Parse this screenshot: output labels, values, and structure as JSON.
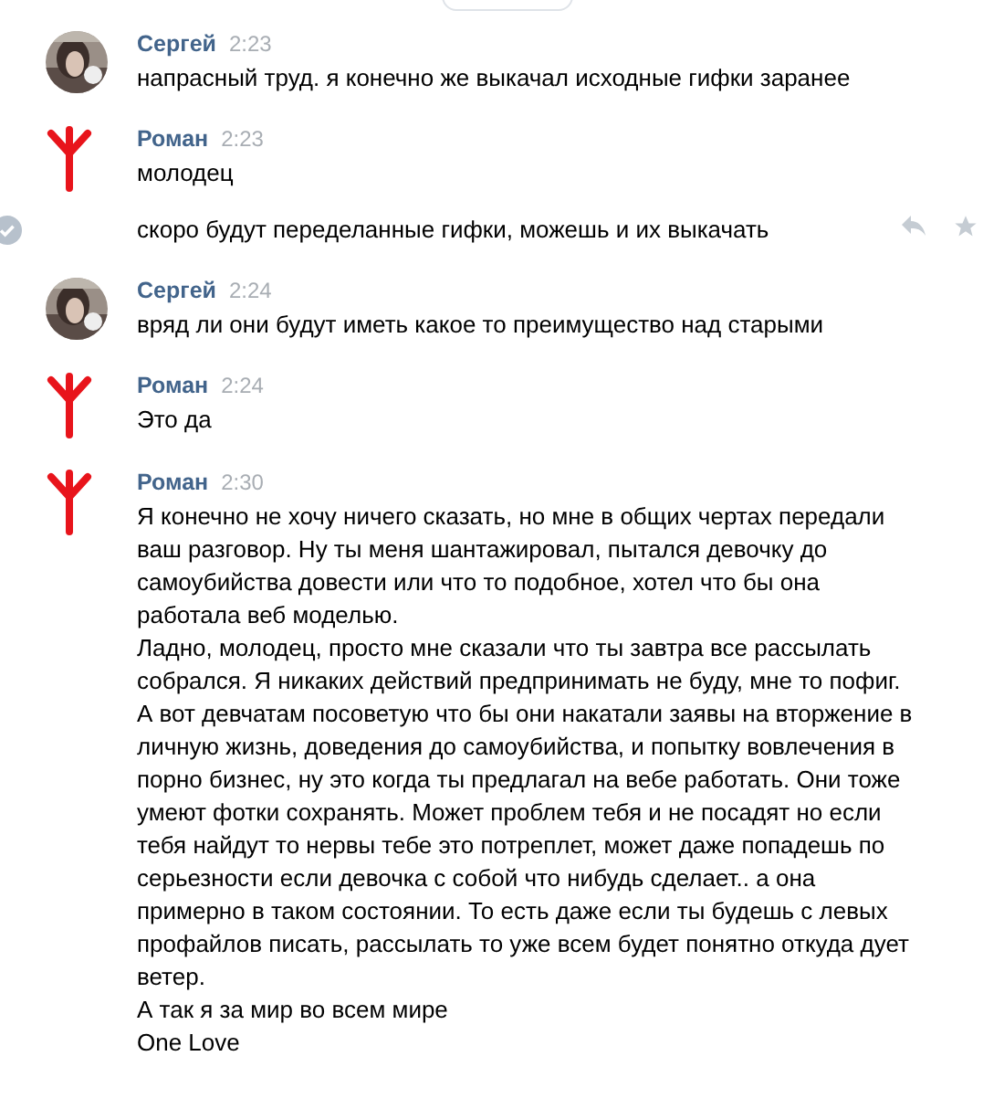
{
  "groups": [
    {
      "author": "Сергей",
      "time": "2:23",
      "messages": [
        {
          "text": [
            "напрасный труд. я конечно же выкачал исходные гифки заранее"
          ],
          "show_actions": false
        }
      ]
    },
    {
      "author": "Роман",
      "time": "2:23",
      "kind": "rune",
      "messages": [
        {
          "text": [
            "молодец"
          ],
          "show_actions": false
        },
        {
          "text": [
            "скоро будут переделанные гифки, можешь и их выкачать"
          ],
          "show_actions": true
        }
      ]
    },
    {
      "author": "Сергей",
      "time": "2:24",
      "messages": [
        {
          "text": [
            "вряд ли они будут иметь какое то преимущество над старыми"
          ],
          "show_actions": false
        }
      ]
    },
    {
      "author": "Роман",
      "time": "2:24",
      "kind": "rune",
      "messages": [
        {
          "text": [
            "Это да"
          ],
          "show_actions": false
        }
      ]
    },
    {
      "author": "Роман",
      "time": "2:30",
      "kind": "rune",
      "messages": [
        {
          "text": [
            "Я конечно не хочу ничего сказать, но мне в общих чертах передали ваш разговор. Ну ты меня шантажировал, пытался девочку до самоубийства довести или что то подобное, хотел что бы она работала веб моделью.",
            "Ладно, молодец, просто мне сказали что ты завтра все рассылать собрался. Я никаких действий предпринимать не буду, мне то пофиг. А вот девчатам посоветую что бы они накатали заявы на вторжение в личную жизнь, доведения до самоубийства, и попытку вовлечения в порно бизнес, ну это когда ты предлагал на вебе работать. Они тоже умеют фотки сохранять. Может проблем тебя и не посадят но если тебя найдут то нервы тебе это потреплет, может даже попадешь по серьезности если девочка с собой что нибудь сделает.. а она примерно в таком состоянии. То есть даже если ты будешь с левых профайлов писать, рассылать то уже всем будет понятно откуда дует ветер.",
            "А так я за мир во всем мире",
            "One Love"
          ],
          "show_actions": false
        }
      ]
    }
  ]
}
